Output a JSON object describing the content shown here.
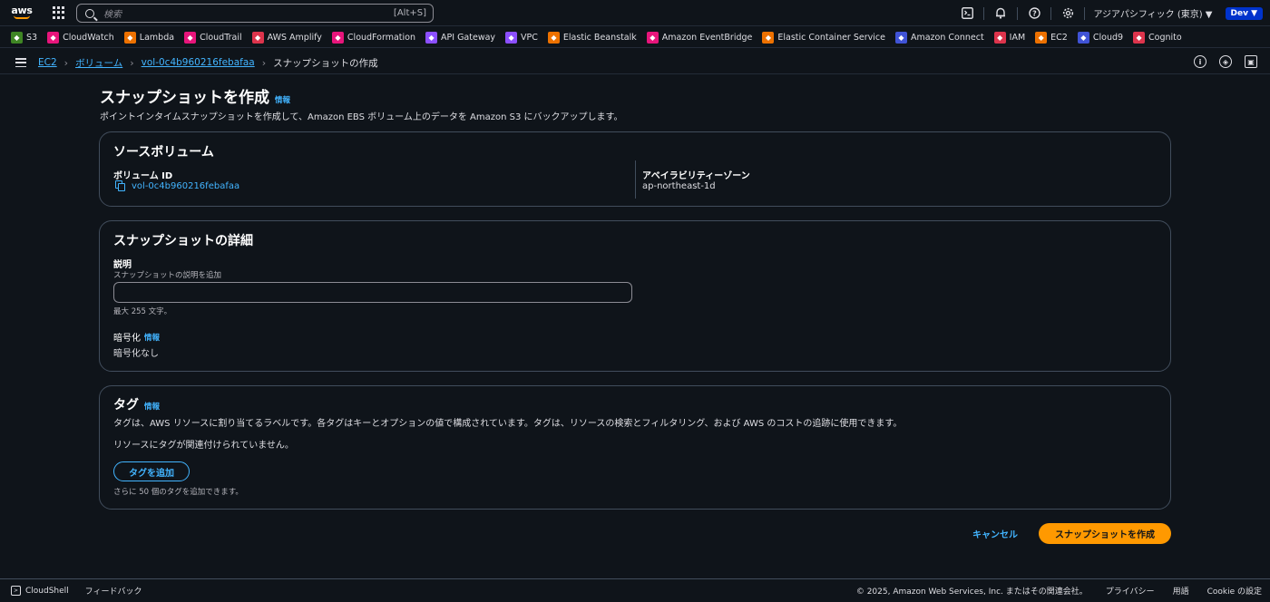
{
  "topnav": {
    "search_placeholder": "検索",
    "search_shortcut": "[Alt+S]",
    "region": "アジアパシフィック (東京) ▼",
    "account_badge": "Dev ▼"
  },
  "favorites": [
    {
      "label": "S3",
      "color": "#3f8624",
      "icon": "s3-icon"
    },
    {
      "label": "CloudWatch",
      "color": "#e7157b",
      "icon": "cloudwatch-icon"
    },
    {
      "label": "Lambda",
      "color": "#ed7100",
      "icon": "lambda-icon"
    },
    {
      "label": "CloudTrail",
      "color": "#e7157b",
      "icon": "cloudtrail-icon"
    },
    {
      "label": "AWS Amplify",
      "color": "#dd344c",
      "icon": "amplify-icon"
    },
    {
      "label": "CloudFormation",
      "color": "#e7157b",
      "icon": "cloudformation-icon"
    },
    {
      "label": "API Gateway",
      "color": "#8c4fff",
      "icon": "api-gateway-icon"
    },
    {
      "label": "VPC",
      "color": "#8c4fff",
      "icon": "vpc-icon"
    },
    {
      "label": "Elastic Beanstalk",
      "color": "#ed7100",
      "icon": "beanstalk-icon"
    },
    {
      "label": "Amazon EventBridge",
      "color": "#e7157b",
      "icon": "eventbridge-icon"
    },
    {
      "label": "Elastic Container Service",
      "color": "#ed7100",
      "icon": "ecs-icon"
    },
    {
      "label": "Amazon Connect",
      "color": "#4053d6",
      "icon": "connect-icon"
    },
    {
      "label": "IAM",
      "color": "#dd344c",
      "icon": "iam-icon"
    },
    {
      "label": "EC2",
      "color": "#ed7100",
      "icon": "ec2-icon"
    },
    {
      "label": "Cloud9",
      "color": "#4053d6",
      "icon": "cloud9-icon"
    },
    {
      "label": "Cognito",
      "color": "#dd344c",
      "icon": "cognito-icon"
    }
  ],
  "breadcrumb": {
    "items": [
      "EC2",
      "ボリューム",
      "vol-0c4b960216febafaa"
    ],
    "current": "スナップショットの作成"
  },
  "page": {
    "title": "スナップショットを作成",
    "info": "情報",
    "description": "ポイントインタイムスナップショットを作成して、Amazon EBS ボリューム上のデータを Amazon S3 にバックアップします。"
  },
  "source": {
    "heading": "ソースボリューム",
    "volume_id_label": "ボリューム ID",
    "volume_id": "vol-0c4b960216febafaa",
    "az_label": "アベイラビリティーゾーン",
    "az": "ap-northeast-1d"
  },
  "details": {
    "heading": "スナップショットの詳細",
    "desc_label": "説明",
    "desc_hint": "スナップショットの説明を追加",
    "desc_value": "",
    "desc_constraint": "最大 255 文字。",
    "enc_label": "暗号化",
    "enc_info": "情報",
    "enc_value": "暗号化なし"
  },
  "tags": {
    "heading": "タグ",
    "info": "情報",
    "description": "タグは、AWS リソースに割り当てるラベルです。各タグはキーとオプションの値で構成されています。タグは、リソースの検索とフィルタリング、および AWS のコストの追跡に使用できます。",
    "empty": "リソースにタグが関連付けられていません。",
    "add_button": "タグを追加",
    "remaining": "さらに 50 個のタグを追加できます。"
  },
  "actions": {
    "cancel": "キャンセル",
    "create": "スナップショットを作成"
  },
  "footer": {
    "cloudshell": "CloudShell",
    "feedback": "フィードバック",
    "copyright": "© 2025, Amazon Web Services, Inc. またはその関連会社。",
    "privacy": "プライバシー",
    "terms": "用語",
    "cookie": "Cookie の設定"
  }
}
